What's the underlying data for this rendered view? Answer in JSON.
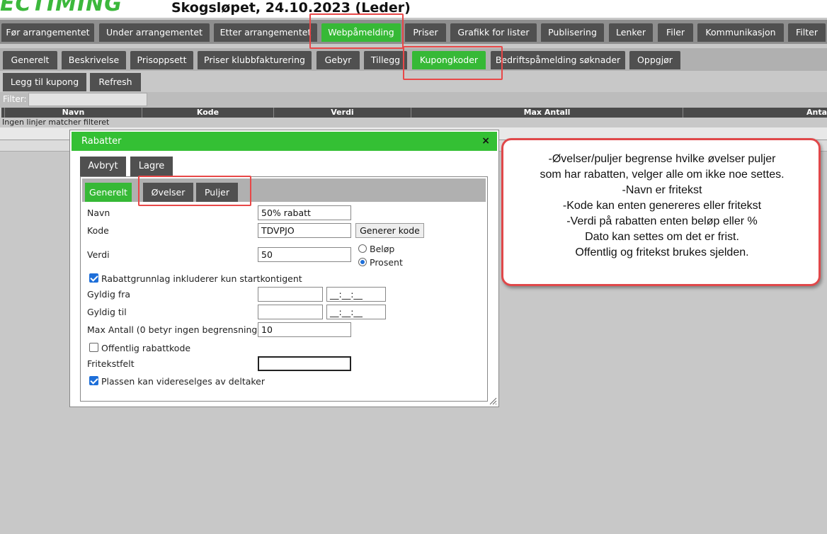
{
  "header": {
    "logo_text": "ECTIMING",
    "title": "Skogsløpet, 24.10.2023 (Leder)"
  },
  "main_nav": [
    {
      "label": "Før arrangementet"
    },
    {
      "label": "Under arrangementet"
    },
    {
      "label": "Etter arrangementet"
    },
    {
      "label": "Webpåmelding"
    },
    {
      "label": "Priser"
    },
    {
      "label": "Grafikk for lister"
    },
    {
      "label": "Publisering"
    },
    {
      "label": "Lenker"
    },
    {
      "label": "Filer"
    },
    {
      "label": "Kommunikasjon"
    },
    {
      "label": "Filter"
    }
  ],
  "sub_nav": [
    {
      "label": "Generelt"
    },
    {
      "label": "Beskrivelse"
    },
    {
      "label": "Prisoppsett"
    },
    {
      "label": "Priser klubbfakturering"
    },
    {
      "label": "Gebyr"
    },
    {
      "label": "Tillegg"
    },
    {
      "label": "Kupongkoder"
    },
    {
      "label": "Bedriftspåmelding søknader"
    },
    {
      "label": "Oppgjør"
    }
  ],
  "toolbar": {
    "add_label": "Legg til kupong",
    "refresh_label": "Refresh"
  },
  "filter": {
    "label": "Filter:",
    "value": ""
  },
  "table": {
    "columns": [
      "Navn",
      "Kode",
      "Verdi",
      "Max Antall",
      "Anta"
    ],
    "empty_text": "Ingen linjer matcher filteret"
  },
  "dialog": {
    "title": "Rabatter",
    "close_label": "×",
    "cancel_label": "Avbryt",
    "save_label": "Lagre",
    "tabs": [
      {
        "label": "Generelt"
      },
      {
        "label": "Øvelser"
      },
      {
        "label": "Puljer"
      }
    ],
    "fields": {
      "navn_label": "Navn",
      "navn_value": "50% rabatt",
      "kode_label": "Kode",
      "kode_value": "TDVPJO",
      "generate_label": "Generer kode",
      "verdi_label": "Verdi",
      "verdi_value": "50",
      "belop_label": "Beløp",
      "prosent_label": "Prosent",
      "selected_type": "Prosent",
      "basis_label": "Rabattgrunnlag inkluderer kun startkontigent",
      "basis_checked": true,
      "gyldig_fra_label": "Gyldig fra",
      "gyldig_fra_date": "",
      "gyldig_fra_time": "__:__:__",
      "gyldig_til_label": "Gyldig til",
      "gyldig_til_date": "",
      "gyldig_til_time": "__:__:__",
      "max_label": "Max Antall (0 betyr ingen begrensning)",
      "max_value": "10",
      "public_label": "Offentlig rabattkode",
      "public_checked": false,
      "fritekst_label": "Fritekstfelt",
      "fritekst_value": "",
      "resell_label": "Plassen kan videreselges av deltaker",
      "resell_checked": true
    }
  },
  "callout": {
    "lines": [
      "-Øvelser/puljer begrense hvilke øvelser puljer",
      "som har rabatten, velger alle om ikke noe settes.",
      "-Navn er fritekst",
      "-Kode kan enten genereres eller fritekst",
      "-Verdi på rabatten enten beløp eller %",
      "Dato kan settes om det er frist.",
      "Offentlig og fritekst brukes sjelden."
    ]
  },
  "colors": {
    "accent_green": "#36b936",
    "tab_dark": "#505050",
    "highlight_red": "#e84848"
  }
}
